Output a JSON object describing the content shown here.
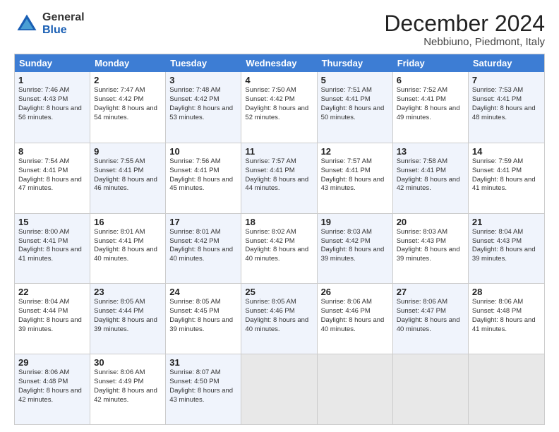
{
  "logo": {
    "line1": "General",
    "line2": "Blue"
  },
  "title": "December 2024",
  "subtitle": "Nebbiuno, Piedmont, Italy",
  "header": {
    "days": [
      "Sunday",
      "Monday",
      "Tuesday",
      "Wednesday",
      "Thursday",
      "Friday",
      "Saturday"
    ]
  },
  "weeks": [
    [
      {
        "num": "1",
        "sunrise": "7:46 AM",
        "sunset": "4:43 PM",
        "daylight": "8 hours and 56 minutes."
      },
      {
        "num": "2",
        "sunrise": "7:47 AM",
        "sunset": "4:42 PM",
        "daylight": "8 hours and 54 minutes."
      },
      {
        "num": "3",
        "sunrise": "7:48 AM",
        "sunset": "4:42 PM",
        "daylight": "8 hours and 53 minutes."
      },
      {
        "num": "4",
        "sunrise": "7:50 AM",
        "sunset": "4:42 PM",
        "daylight": "8 hours and 52 minutes."
      },
      {
        "num": "5",
        "sunrise": "7:51 AM",
        "sunset": "4:41 PM",
        "daylight": "8 hours and 50 minutes."
      },
      {
        "num": "6",
        "sunrise": "7:52 AM",
        "sunset": "4:41 PM",
        "daylight": "8 hours and 49 minutes."
      },
      {
        "num": "7",
        "sunrise": "7:53 AM",
        "sunset": "4:41 PM",
        "daylight": "8 hours and 48 minutes."
      }
    ],
    [
      {
        "num": "8",
        "sunrise": "7:54 AM",
        "sunset": "4:41 PM",
        "daylight": "8 hours and 47 minutes."
      },
      {
        "num": "9",
        "sunrise": "7:55 AM",
        "sunset": "4:41 PM",
        "daylight": "8 hours and 46 minutes."
      },
      {
        "num": "10",
        "sunrise": "7:56 AM",
        "sunset": "4:41 PM",
        "daylight": "8 hours and 45 minutes."
      },
      {
        "num": "11",
        "sunrise": "7:57 AM",
        "sunset": "4:41 PM",
        "daylight": "8 hours and 44 minutes."
      },
      {
        "num": "12",
        "sunrise": "7:57 AM",
        "sunset": "4:41 PM",
        "daylight": "8 hours and 43 minutes."
      },
      {
        "num": "13",
        "sunrise": "7:58 AM",
        "sunset": "4:41 PM",
        "daylight": "8 hours and 42 minutes."
      },
      {
        "num": "14",
        "sunrise": "7:59 AM",
        "sunset": "4:41 PM",
        "daylight": "8 hours and 41 minutes."
      }
    ],
    [
      {
        "num": "15",
        "sunrise": "8:00 AM",
        "sunset": "4:41 PM",
        "daylight": "8 hours and 41 minutes."
      },
      {
        "num": "16",
        "sunrise": "8:01 AM",
        "sunset": "4:41 PM",
        "daylight": "8 hours and 40 minutes."
      },
      {
        "num": "17",
        "sunrise": "8:01 AM",
        "sunset": "4:42 PM",
        "daylight": "8 hours and 40 minutes."
      },
      {
        "num": "18",
        "sunrise": "8:02 AM",
        "sunset": "4:42 PM",
        "daylight": "8 hours and 40 minutes."
      },
      {
        "num": "19",
        "sunrise": "8:03 AM",
        "sunset": "4:42 PM",
        "daylight": "8 hours and 39 minutes."
      },
      {
        "num": "20",
        "sunrise": "8:03 AM",
        "sunset": "4:43 PM",
        "daylight": "8 hours and 39 minutes."
      },
      {
        "num": "21",
        "sunrise": "8:04 AM",
        "sunset": "4:43 PM",
        "daylight": "8 hours and 39 minutes."
      }
    ],
    [
      {
        "num": "22",
        "sunrise": "8:04 AM",
        "sunset": "4:44 PM",
        "daylight": "8 hours and 39 minutes."
      },
      {
        "num": "23",
        "sunrise": "8:05 AM",
        "sunset": "4:44 PM",
        "daylight": "8 hours and 39 minutes."
      },
      {
        "num": "24",
        "sunrise": "8:05 AM",
        "sunset": "4:45 PM",
        "daylight": "8 hours and 39 minutes."
      },
      {
        "num": "25",
        "sunrise": "8:05 AM",
        "sunset": "4:46 PM",
        "daylight": "8 hours and 40 minutes."
      },
      {
        "num": "26",
        "sunrise": "8:06 AM",
        "sunset": "4:46 PM",
        "daylight": "8 hours and 40 minutes."
      },
      {
        "num": "27",
        "sunrise": "8:06 AM",
        "sunset": "4:47 PM",
        "daylight": "8 hours and 40 minutes."
      },
      {
        "num": "28",
        "sunrise": "8:06 AM",
        "sunset": "4:48 PM",
        "daylight": "8 hours and 41 minutes."
      }
    ],
    [
      {
        "num": "29",
        "sunrise": "8:06 AM",
        "sunset": "4:48 PM",
        "daylight": "8 hours and 42 minutes."
      },
      {
        "num": "30",
        "sunrise": "8:06 AM",
        "sunset": "4:49 PM",
        "daylight": "8 hours and 42 minutes."
      },
      {
        "num": "31",
        "sunrise": "8:07 AM",
        "sunset": "4:50 PM",
        "daylight": "8 hours and 43 minutes."
      },
      null,
      null,
      null,
      null
    ]
  ]
}
